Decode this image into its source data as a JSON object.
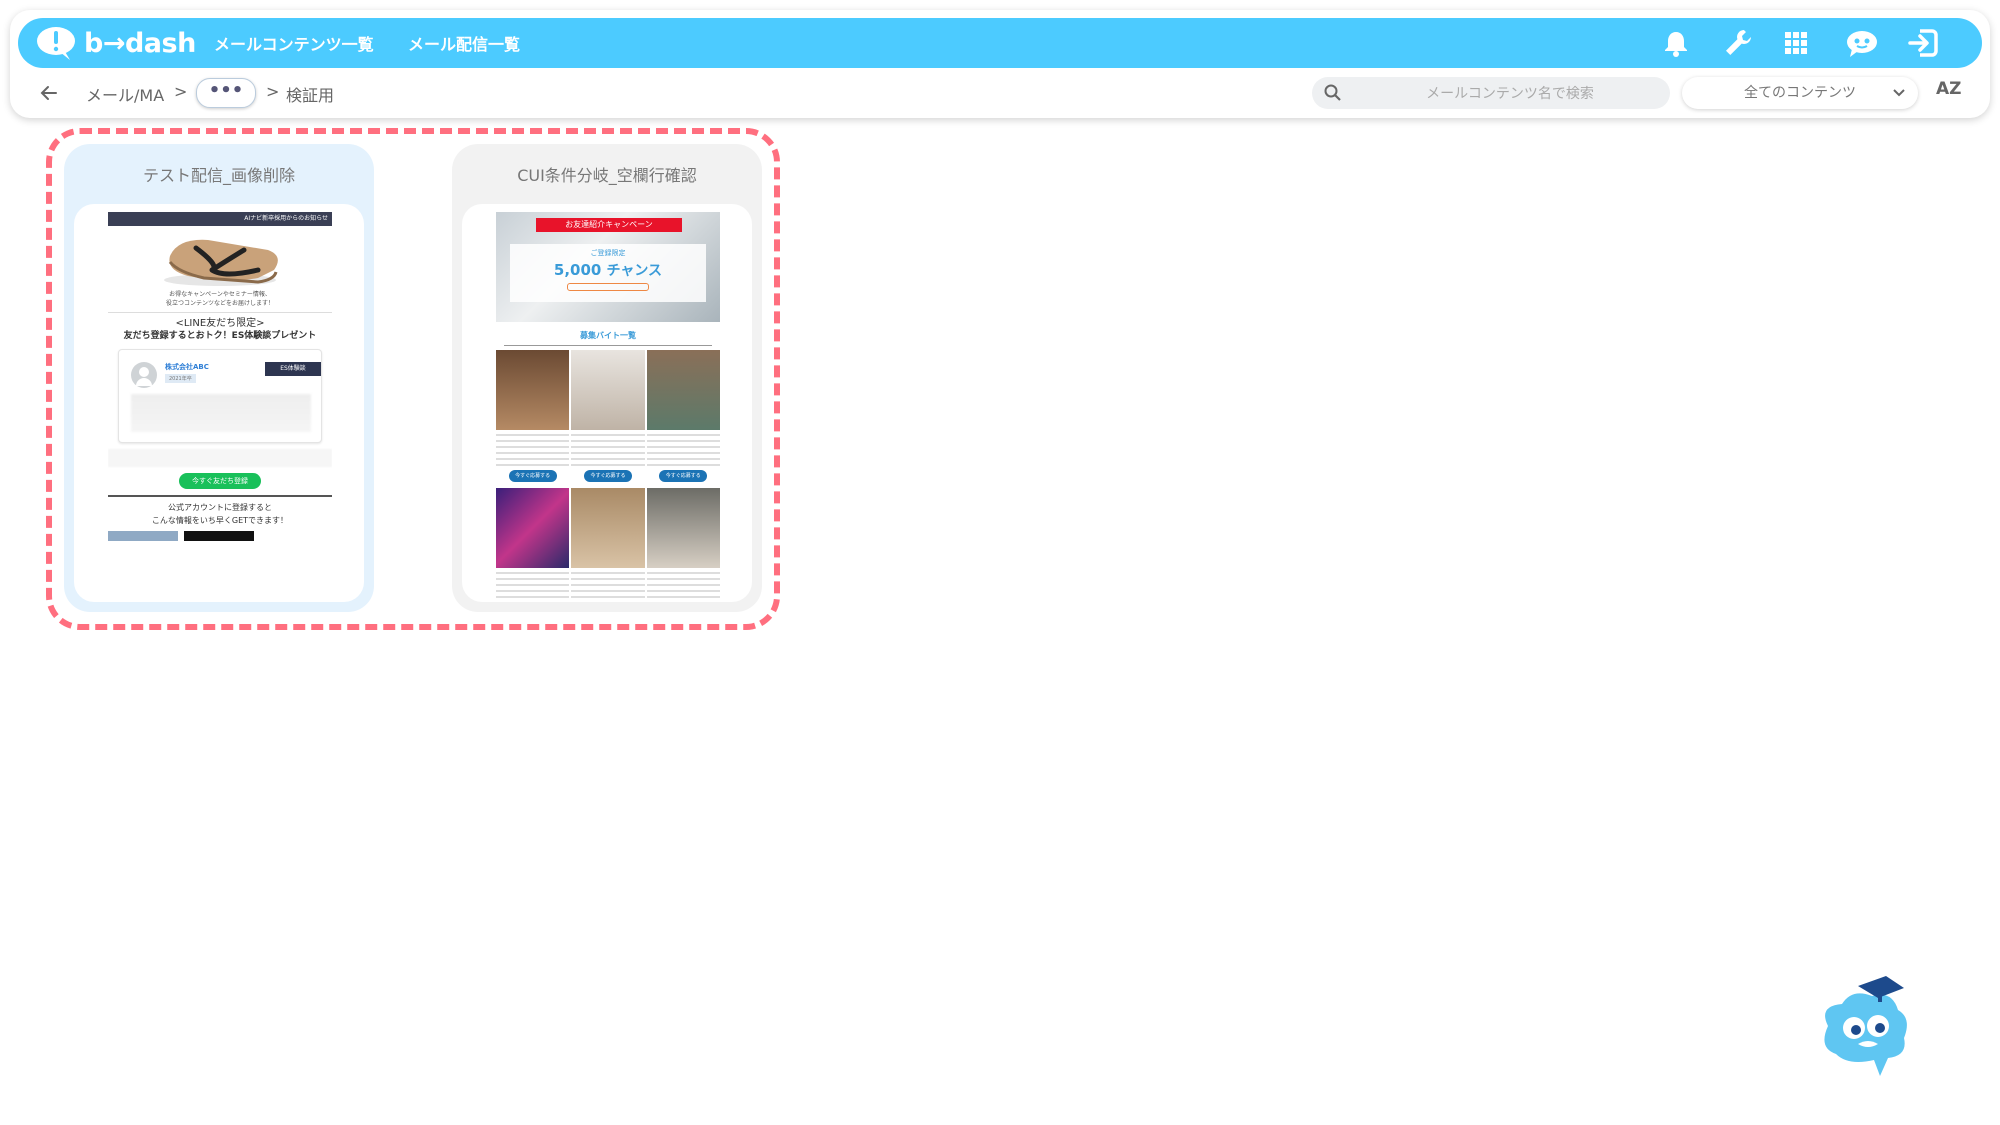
{
  "app": {
    "logo_text": "b→dash",
    "colors": {
      "brand": "#4ccbff",
      "highlight": "#ff6f7f",
      "line_green": "#19c05a"
    }
  },
  "topbar": {
    "nav": [
      {
        "label": "メールコンテンツ一覧"
      },
      {
        "label": "メール配信一覧"
      }
    ],
    "icons": [
      "bell-icon",
      "wrench-icon",
      "grid-icon",
      "chatbot-icon",
      "logout-icon"
    ]
  },
  "breadcrumb": {
    "root": "メール/MA",
    "sep1": ">",
    "ellipsis": "•••",
    "sep2": ">",
    "current": "検証用"
  },
  "search": {
    "placeholder": "メールコンテンツ名で検索"
  },
  "filter": {
    "selected": "全てのコンテンツ"
  },
  "sort": {
    "label": "AZ"
  },
  "cards": [
    {
      "title": "テスト配信_画像削除",
      "preview": {
        "header_text": "AIナビ新卒採用からのお知らせ",
        "intro_line1": "お得なキャンペーンやセミナー情報、",
        "intro_line2": "役立つコンテンツなどをお届けします！",
        "heading1": "<LINE友だち限定>",
        "heading2": "友だち登録するとおトク！ES体験談プレゼント",
        "company": "株式会社ABC",
        "tag": "ES体験談",
        "year": "2021年卒",
        "button": "今すぐ友だち登録",
        "footer_line1": "公式アカウントに登録すると",
        "footer_line2": "こんな情報をいち早くGETできます！"
      }
    },
    {
      "title": "CUI条件分岐_空欄行確認",
      "preview": {
        "banner": "お友達紹介キャンペーン",
        "limit": "ご登録限定",
        "amount": "5,000",
        "chance": "チャンス",
        "section": "募集バイト一覧",
        "button": "今すぐ応募する"
      }
    }
  ]
}
